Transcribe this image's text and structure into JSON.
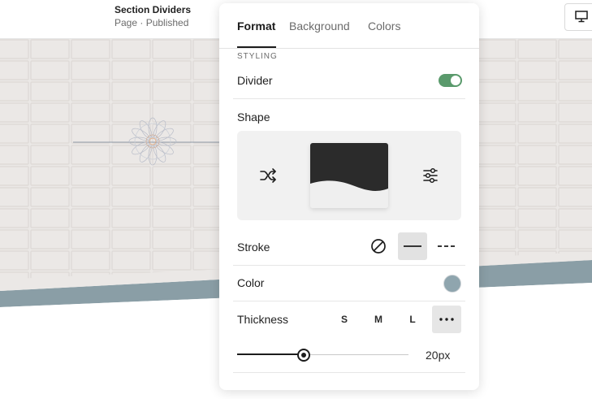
{
  "page": {
    "title": "Section Dividers",
    "subtitle": "Page · Published"
  },
  "toolbar": {
    "device_icon": "desktop-monitor-icon"
  },
  "panel": {
    "tabs": [
      {
        "label": "Format",
        "active": true
      },
      {
        "label": "Background",
        "active": false
      },
      {
        "label": "Colors",
        "active": false
      }
    ],
    "section_label": "STYLING",
    "divider": {
      "label": "Divider",
      "enabled": true,
      "toggle_color": "#5a9a6c"
    },
    "shape": {
      "label": "Shape",
      "shuffle_icon": "shuffle-icon",
      "settings_icon": "sliders-icon",
      "preview_fill": "#2b2b2b",
      "preview_base": "#efefef"
    },
    "stroke": {
      "label": "Stroke",
      "options": [
        "none",
        "solid",
        "dashed"
      ],
      "selected": "solid"
    },
    "color": {
      "label": "Color",
      "value": "#8fa5ae"
    },
    "thickness": {
      "label": "Thickness",
      "options": [
        "S",
        "M",
        "L"
      ],
      "custom_icon": "more-icon",
      "selected": "custom",
      "value_text": "20px",
      "slider_fraction": 0.39
    }
  },
  "canvas": {
    "background": "#ebe8e6",
    "divider_color": "#8a9ea6"
  }
}
